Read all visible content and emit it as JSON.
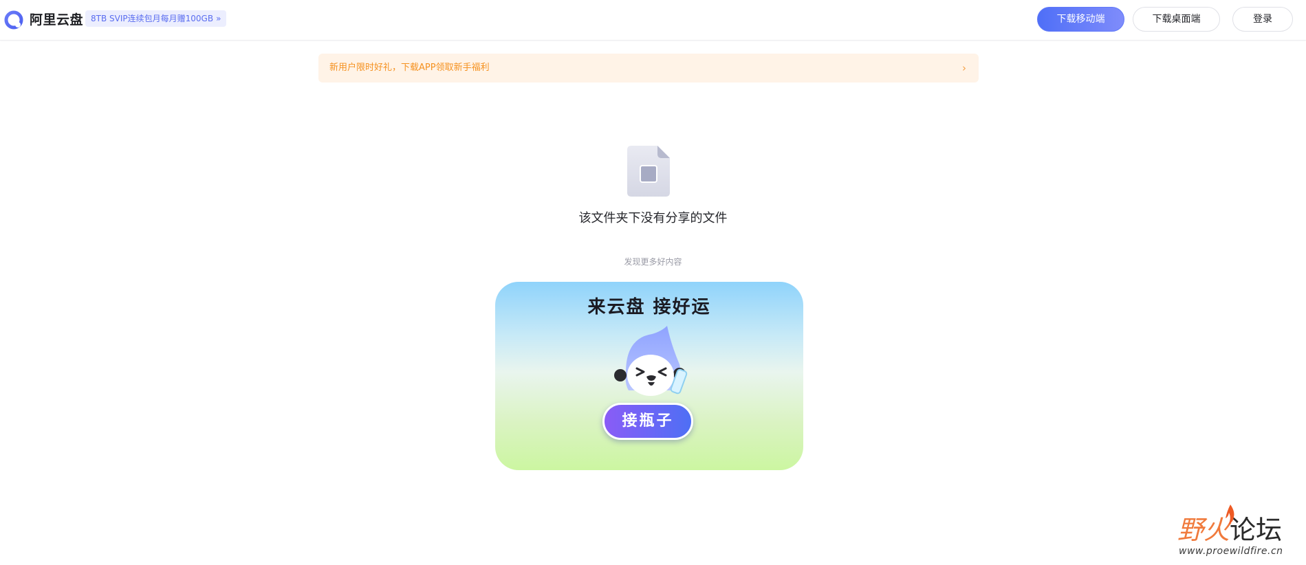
{
  "header": {
    "brand": "阿里云盘",
    "promo_badge": "8TB SVIP连续包月每月赠100GB",
    "promo_chevron": "»",
    "download_mobile": "下载移动端",
    "download_desktop": "下载桌面端",
    "login": "登录"
  },
  "notice": {
    "text": "新用户限时好礼，下载APP领取新手福利",
    "arrow": "›"
  },
  "empty_state": {
    "message": "该文件夹下没有分享的文件",
    "discover": "发现更多好内容"
  },
  "banner": {
    "title": "来云盘 接好运",
    "cta": "接瓶子"
  },
  "watermark": {
    "title_a": "野火",
    "title_b": "论坛",
    "url": "www.proewildfire.cn"
  },
  "colors": {
    "accent": "#5a6df0",
    "notice_text": "#f5911f",
    "notice_bg": "#fff3e7"
  }
}
